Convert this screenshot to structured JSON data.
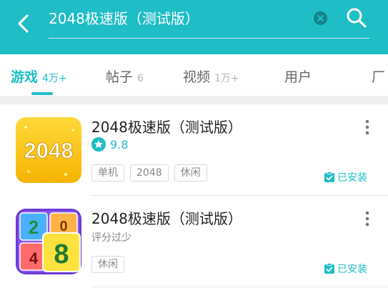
{
  "header": {
    "search_value": "2048极速版（测试版）",
    "accent_color": "#1fbdc6"
  },
  "tabs": [
    {
      "label": "游戏",
      "count": "4万+",
      "active": true
    },
    {
      "label": "帖子",
      "count": "6",
      "active": false
    },
    {
      "label": "视频",
      "count": "1万+",
      "active": false
    },
    {
      "label": "用户",
      "count": "",
      "active": false
    },
    {
      "label": "厂",
      "count": "",
      "active": false
    }
  ],
  "results": [
    {
      "title": "2048极速版（测试版）",
      "rating": "9.8",
      "tags": [
        "单机",
        "2048",
        "休闲"
      ],
      "status": "已安装",
      "icon": "2048-yellow-icon",
      "icon_text": "2048"
    },
    {
      "title": "2048极速版（测试版）",
      "subtitle": "评分过少",
      "tags": [
        "休闲"
      ],
      "status": "已安装",
      "icon": "number-blocks-icon",
      "icon_digits": [
        "2",
        "0",
        "4",
        "8"
      ]
    }
  ]
}
